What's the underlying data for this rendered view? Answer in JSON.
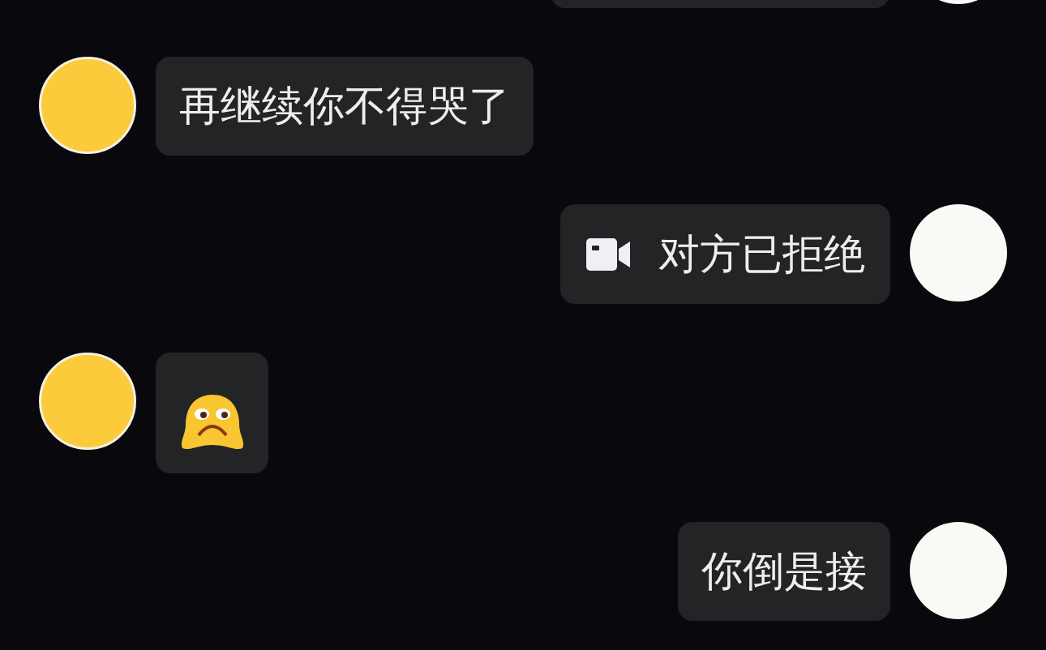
{
  "messages": [
    {
      "outgoing": true,
      "kind": "cut_off"
    },
    {
      "outgoing": false,
      "kind": "text",
      "text": "再继续你不得哭了"
    },
    {
      "outgoing": true,
      "kind": "video_call",
      "text": "对方已拒绝"
    },
    {
      "outgoing": false,
      "kind": "sticker"
    },
    {
      "outgoing": true,
      "kind": "text",
      "text": "你倒是接"
    }
  ]
}
